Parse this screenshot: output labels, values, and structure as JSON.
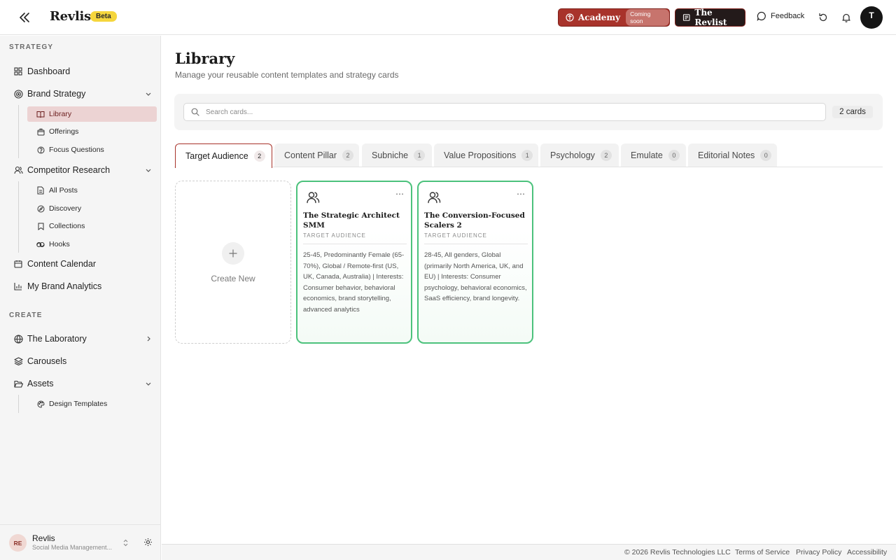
{
  "header": {
    "brand": "Revlis",
    "beta": "Beta",
    "academy_label": "Academy",
    "academy_badge": "Coming soon",
    "revlist_label": "The Revlist",
    "feedback_label": "Feedback",
    "avatar_initial": "T"
  },
  "sidebar": {
    "strategy_heading": "STRATEGY",
    "create_heading": "CREATE",
    "dashboard": "Dashboard",
    "brand_strategy": "Brand Strategy",
    "brand_strategy_items": [
      "Library",
      "Offerings",
      "Focus Questions"
    ],
    "competitor_research": "Competitor Research",
    "competitor_items": [
      "All Posts",
      "Discovery",
      "Collections",
      "Hooks"
    ],
    "content_calendar": "Content Calendar",
    "analytics": "My Brand Analytics",
    "laboratory": "The Laboratory",
    "carousels": "Carousels",
    "assets": "Assets",
    "assets_items": [
      "Design Templates"
    ],
    "active_item": "Library"
  },
  "user": {
    "initials": "RE",
    "name": "Revlis",
    "subtitle": "Social Media Management..."
  },
  "main": {
    "title": "Library",
    "subtitle": "Manage your reusable content templates and strategy cards",
    "search_placeholder": "Search cards...",
    "card_count": "2 cards",
    "create_new": "Create New"
  },
  "tabs": [
    {
      "label": "Target Audience",
      "count": "2",
      "active": true
    },
    {
      "label": "Content Pillar",
      "count": "2",
      "active": false
    },
    {
      "label": "Subniche",
      "count": "1",
      "active": false
    },
    {
      "label": "Value Propositions",
      "count": "1",
      "active": false
    },
    {
      "label": "Psychology",
      "count": "2",
      "active": false
    },
    {
      "label": "Emulate",
      "count": "0",
      "active": false
    },
    {
      "label": "Editorial Notes",
      "count": "0",
      "active": false
    }
  ],
  "cards": [
    {
      "title": "The Strategic Architect SMM",
      "kind": "TARGET AUDIENCE",
      "description": "25-45, Predominantly Female (65-70%), Global / Remote-first (US, UK, Canada, Australia) | Interests: Consumer behavior, behavioral economics, brand storytelling, advanced analytics"
    },
    {
      "title": "The Conversion-Focused Scalers 2",
      "kind": "TARGET AUDIENCE",
      "description": "28-45, All genders, Global (primarily North America, UK, and EU) | Interests: Consumer psychology, behavioral economics, SaaS efficiency, brand longevity."
    }
  ],
  "footer": {
    "copyright": "© 2026 Revlis Technologies LLC",
    "terms": "Terms of Service",
    "privacy": "Privacy Policy",
    "accessibility": "Accessibility"
  },
  "colors": {
    "accent": "#a8332b",
    "beta": "#f5d63d",
    "card_border": "#4cc27c",
    "active_nav_bg": "#ecd3d3"
  }
}
